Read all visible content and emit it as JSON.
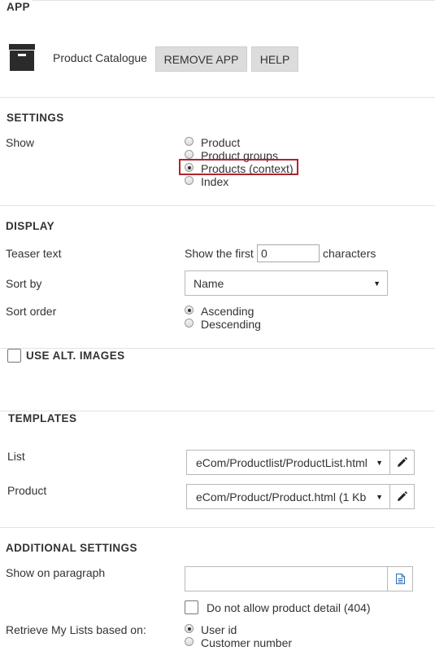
{
  "app": {
    "section_title": "APP",
    "name": "Product Catalogue",
    "remove_label": "REMOVE APP",
    "help_label": "HELP"
  },
  "settings": {
    "section_title": "SETTINGS",
    "show_label": "Show",
    "options": [
      "Product",
      "Product groups",
      "Products (context)",
      "Index"
    ],
    "selected": "Products (context)"
  },
  "display": {
    "section_title": "DISPLAY",
    "teaser_label": "Teaser text",
    "teaser_prefix": "Show the first",
    "teaser_value": "0",
    "teaser_suffix": "characters",
    "sort_by_label": "Sort by",
    "sort_by_value": "Name",
    "sort_order_label": "Sort order",
    "sort_order_options": [
      "Ascending",
      "Descending"
    ],
    "sort_order_selected": "Ascending"
  },
  "alt_images": {
    "label": "USE ALT. IMAGES",
    "checked": false
  },
  "templates": {
    "section_title": "TEMPLATES",
    "list_label": "List",
    "list_value": "eCom/Productlist/ProductList.html",
    "product_label": "Product",
    "product_value": "eCom/Product/Product.html (1 Kb"
  },
  "additional": {
    "section_title": "ADDITIONAL SETTINGS",
    "show_on_paragraph_label": "Show on paragraph",
    "show_on_paragraph_value": "",
    "no_detail_label": "Do not allow product detail (404)",
    "no_detail_checked": false,
    "retrieve_label": "Retrieve My Lists based on:",
    "retrieve_options": [
      "User id",
      "Customer number"
    ],
    "retrieve_selected": "User id"
  },
  "colors": {
    "highlight_box": "#b0252c",
    "button_bg": "#dcdcdc",
    "divider": "#e3e3e3"
  },
  "icons": {
    "app_icon": "archive-box-icon",
    "edit_icon": "pencil-icon",
    "paragraph_icon": "document-icon"
  }
}
